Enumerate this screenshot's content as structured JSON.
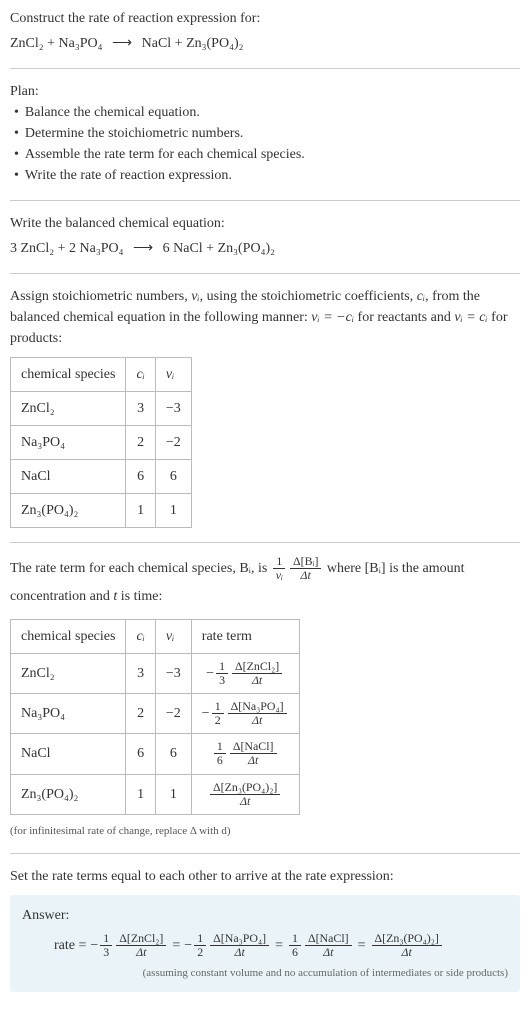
{
  "intro": {
    "title": "Construct the rate of reaction expression for:",
    "equation_lhs": "ZnCl₂ + Na₃PO₄",
    "arrow": "⟶",
    "equation_rhs": "NaCl + Zn₃(PO₄)₂"
  },
  "plan": {
    "title": "Plan:",
    "items": [
      "Balance the chemical equation.",
      "Determine the stoichiometric numbers.",
      "Assemble the rate term for each chemical species.",
      "Write the rate of reaction expression."
    ]
  },
  "balanced": {
    "title": "Write the balanced chemical equation:",
    "equation_lhs": "3 ZnCl₂ + 2 Na₃PO₄",
    "arrow": "⟶",
    "equation_rhs": "6 NaCl + Zn₃(PO₄)₂"
  },
  "stoich_assign": {
    "text_a": "Assign stoichiometric numbers, ",
    "nu_i": "νᵢ",
    "text_b": ", using the stoichiometric coefficients, ",
    "c_i": "cᵢ",
    "text_c": ", from the balanced chemical equation in the following manner: ",
    "eq_react": "νᵢ = −cᵢ",
    "text_d": " for reactants and ",
    "eq_prod": "νᵢ = cᵢ",
    "text_e": " for products:"
  },
  "table1": {
    "headers": [
      "chemical species",
      "cᵢ",
      "νᵢ"
    ],
    "rows": [
      [
        "ZnCl₂",
        "3",
        "−3"
      ],
      [
        "Na₃PO₄",
        "2",
        "−2"
      ],
      [
        "NaCl",
        "6",
        "6"
      ],
      [
        "Zn₃(PO₄)₂",
        "1",
        "1"
      ]
    ]
  },
  "rate_term_intro": {
    "text_a": "The rate term for each chemical species, Bᵢ, is ",
    "frac1_num": "1",
    "frac1_den": "νᵢ",
    "frac2_num": "Δ[Bᵢ]",
    "frac2_den": "Δt",
    "text_b": " where [Bᵢ] is the amount concentration and ",
    "t": "t",
    "text_c": " is time:"
  },
  "table2": {
    "headers": [
      "chemical species",
      "cᵢ",
      "νᵢ",
      "rate term"
    ],
    "rows": [
      {
        "species": "ZnCl₂",
        "c": "3",
        "nu": "−3",
        "neg": "−",
        "fnum1": "1",
        "fden1": "3",
        "fnum2": "Δ[ZnCl₂]",
        "fden2": "Δt"
      },
      {
        "species": "Na₃PO₄",
        "c": "2",
        "nu": "−2",
        "neg": "−",
        "fnum1": "1",
        "fden1": "2",
        "fnum2": "Δ[Na₃PO₄]",
        "fden2": "Δt"
      },
      {
        "species": "NaCl",
        "c": "6",
        "nu": "6",
        "neg": "",
        "fnum1": "1",
        "fden1": "6",
        "fnum2": "Δ[NaCl]",
        "fden2": "Δt"
      },
      {
        "species": "Zn₃(PO₄)₂",
        "c": "1",
        "nu": "1",
        "neg": "",
        "fnum1": "",
        "fden1": "",
        "fnum2": "Δ[Zn₃(PO₄)₂]",
        "fden2": "Δt"
      }
    ],
    "note": "(for infinitesimal rate of change, replace Δ with d)"
  },
  "final": {
    "title": "Set the rate terms equal to each other to arrive at the rate expression:"
  },
  "answer": {
    "label": "Answer:",
    "rate_label": "rate =",
    "terms": [
      {
        "neg": "−",
        "fnum1": "1",
        "fden1": "3",
        "fnum2": "Δ[ZnCl₂]",
        "fden2": "Δt"
      },
      {
        "neg": "−",
        "fnum1": "1",
        "fden1": "2",
        "fnum2": "Δ[Na₃PO₄]",
        "fden2": "Δt"
      },
      {
        "neg": "",
        "fnum1": "1",
        "fden1": "6",
        "fnum2": "Δ[NaCl]",
        "fden2": "Δt"
      },
      {
        "neg": "",
        "fnum1": "",
        "fden1": "",
        "fnum2": "Δ[Zn₃(PO₄)₂]",
        "fden2": "Δt"
      }
    ],
    "eq": "=",
    "note": "(assuming constant volume and no accumulation of intermediates or side products)"
  }
}
